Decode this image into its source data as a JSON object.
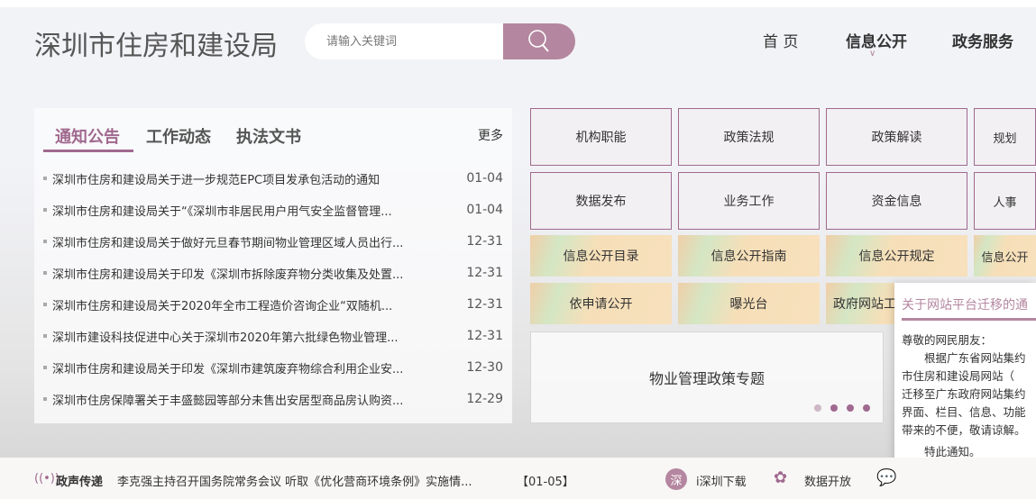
{
  "header": {
    "title": "深圳市住房和建设局",
    "search_placeholder": "请输入关键词",
    "nav": [
      {
        "label": "首 页"
      },
      {
        "label": "信息公开"
      },
      {
        "label": "政务服务"
      }
    ]
  },
  "news": {
    "tabs": [
      {
        "label": "通知公告"
      },
      {
        "label": "工作动态"
      },
      {
        "label": "执法文书"
      }
    ],
    "more": "更多",
    "items": [
      {
        "title": "深圳市住房和建设局关于进一步规范EPC项目发承包活动的通知",
        "date": "01-04"
      },
      {
        "title": "深圳市住房和建设局关于“《深圳市非居民用户用气安全监督管理...",
        "date": "01-04"
      },
      {
        "title": "深圳市住房和建设局关于做好元旦春节期间物业管理区域人员出行...",
        "date": "12-31"
      },
      {
        "title": "深圳市住房和建设局关于印发《深圳市拆除废弃物分类收集及处置...",
        "date": "12-31"
      },
      {
        "title": "深圳市住房和建设局关于2020年全市工程造价咨询企业“双随机...",
        "date": "12-31"
      },
      {
        "title": "深圳市建设科技促进中心关于深圳市2020年第六批绿色物业管理...",
        "date": "12-31"
      },
      {
        "title": "深圳市住房和建设局关于印发《深圳市建筑废弃物综合利用企业安...",
        "date": "12-30"
      },
      {
        "title": "深圳市住房保障署关于丰盛懿园等部分未售出安居型商品房认购资...",
        "date": "12-29"
      }
    ]
  },
  "tiles": {
    "row1": [
      "机构职能",
      "政策法规",
      "政策解读",
      "规划"
    ],
    "row2": [
      "数据发布",
      "业务工作",
      "资金信息",
      "人事"
    ],
    "row3": [
      "信息公开目录",
      "信息公开指南",
      "信息公开规定",
      "信息公开"
    ],
    "row4": [
      "依申请公开",
      "曝光台",
      "政府网站工"
    ]
  },
  "banner": {
    "label": "物业管理政策专题"
  },
  "popup": {
    "title": "关于网站平台迁移的通",
    "lines": [
      "尊敬的网民朋友：",
      "　　根据广东省网站集约",
      "市住房和建设局网站（",
      "迁移至广东政府网站集约",
      "界面、栏目、信息、功能",
      "带来的不便，敬请谅解。",
      "　　特此通知。"
    ]
  },
  "footer": {
    "label": "政声传递",
    "headline": "李克强主持召开国务院常务会议 听取《优化营商环境条例》实施情...",
    "date": "【01-05】",
    "download_icon_char": "深",
    "download": "i深圳下载",
    "data_open": "数据开放"
  },
  "colors": {
    "accent": "#b4869f",
    "tab_active": "#a0698f"
  }
}
